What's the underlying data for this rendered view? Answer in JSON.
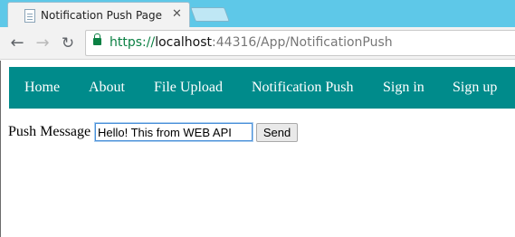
{
  "browser": {
    "tab_title": "Notification Push Page",
    "tab_close": "✕",
    "back_glyph": "←",
    "forward_glyph": "→",
    "reload_glyph": "↻",
    "url": {
      "scheme": "https://",
      "host": "localhost",
      "path": ":44316/App/NotificationPush"
    },
    "colors": {
      "tab_strip": "#5ec8e8",
      "secure_green": "#0b8043"
    },
    "icons": [
      "page-favicon-icon",
      "close-icon",
      "back-arrow-icon",
      "forward-arrow-icon",
      "reload-icon",
      "lock-icon"
    ]
  },
  "navbar": {
    "background": "#008b8b",
    "items": [
      "Home",
      "About",
      "File Upload",
      "Notification Push",
      "Sign in",
      "Sign up"
    ]
  },
  "form": {
    "label": "Push Message",
    "input_value": "Hello! This from WEB API",
    "send_label": "Send"
  }
}
